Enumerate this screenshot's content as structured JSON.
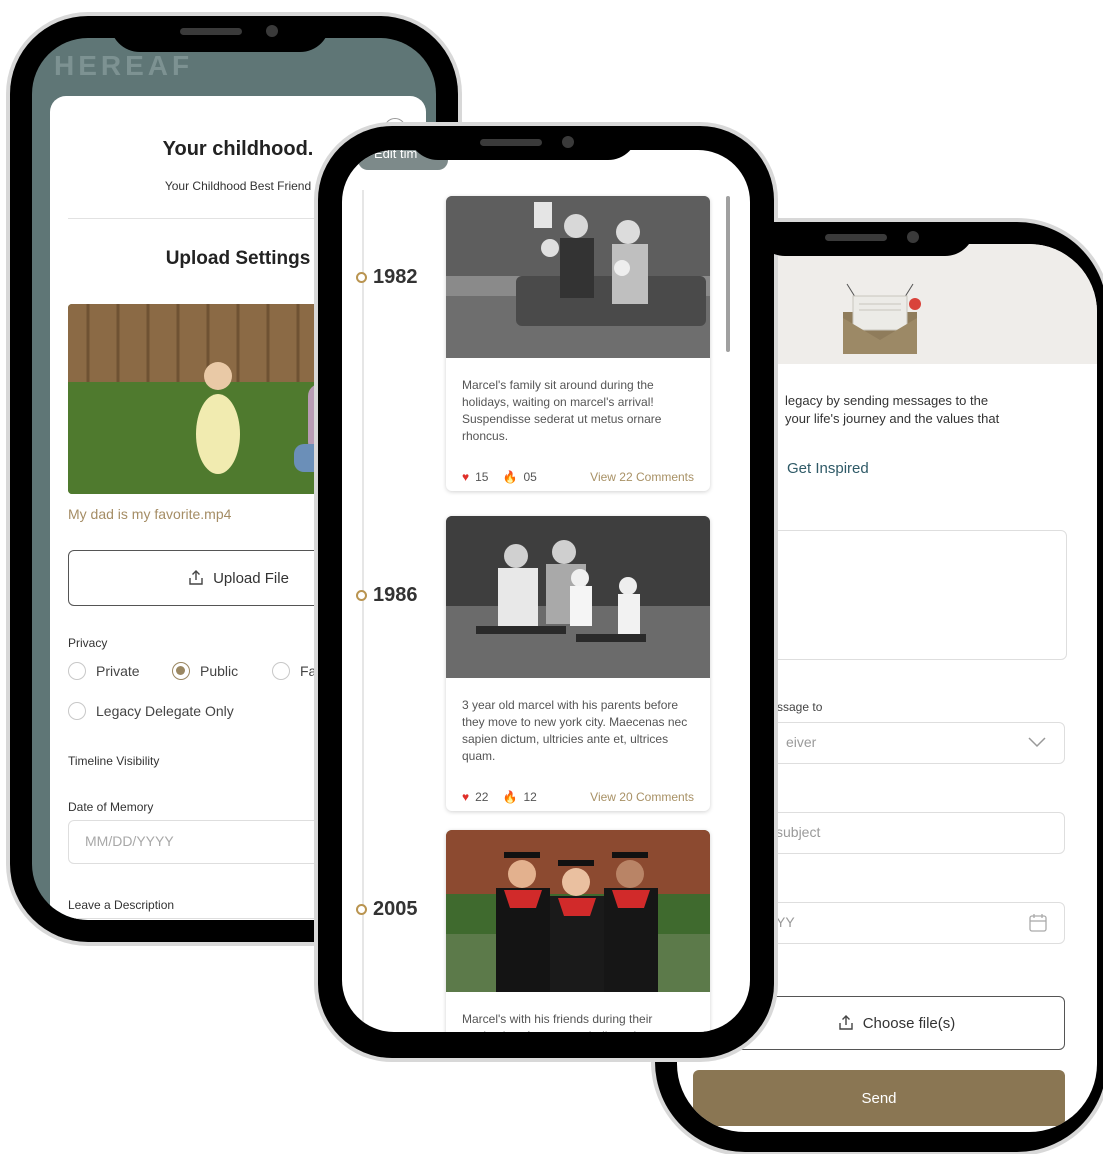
{
  "colors": {
    "accent": "#8a7653",
    "link": "#2f5a67",
    "gold": "#b99450",
    "filename": "#a58d65"
  },
  "left_phone": {
    "header_partial": "HEREAF",
    "modal": {
      "title": "Your childhood.",
      "subtitle": "Your Childhood Best Friend",
      "section_title": "Upload Settings",
      "file_name": "My dad is my favorite.mp4",
      "upload_button": "Upload File",
      "privacy_label": "Privacy",
      "privacy_options": [
        "Private",
        "Public",
        "Fa"
      ],
      "privacy_selected": "Public",
      "legacy_option": "Legacy Delegate Only",
      "timeline_visibility_label": "Timeline Visibility",
      "date_label": "Date of Memory",
      "date_placeholder": "MM/DD/YYYY",
      "description_label": "Leave a Description"
    }
  },
  "middle_phone": {
    "edit_tab": "Edit tim",
    "timeline": [
      {
        "year": "1982",
        "text": "Marcel's family sit around during the holidays, waiting on marcel's arrival! Suspendisse sederat ut metus ornare rhoncus.",
        "hearts": "15",
        "fires": "05",
        "comments": "View 22 Comments"
      },
      {
        "year": "1986",
        "text": "3 year old marcel with his parents before they move to new york city. Maecenas nec sapien dictum, ultricies ante et, ultrices quam.",
        "hearts": "22",
        "fires": "12",
        "comments": "View 20 Comments"
      },
      {
        "year": "2005",
        "text": "Marcel's with his friends during their graduation. Aenean sagit diam sit amet"
      }
    ]
  },
  "right_phone": {
    "intro_line1": "legacy by sending messages to the",
    "intro_line2": "your life's journey and the values that",
    "get_inspired": "Get Inspired",
    "send_to_label": "ssage to",
    "receiver_placeholder": "eiver",
    "subject_placeholder": "subject",
    "date_placeholder": "YY",
    "choose_files": "Choose file(s)",
    "send_button": "Send"
  }
}
